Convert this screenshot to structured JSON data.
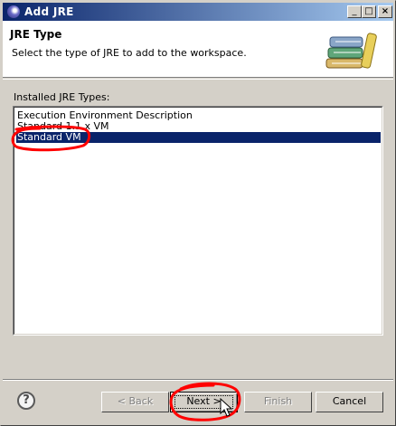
{
  "window": {
    "title": "Add JRE",
    "minimize_glyph": "_",
    "maximize_glyph": "□",
    "close_glyph": "×"
  },
  "header": {
    "title": "JRE Type",
    "description": "Select the type of JRE to add to the workspace.",
    "icon": "books-icon"
  },
  "installed_types": {
    "label": "Installed JRE Types:",
    "items": [
      {
        "label": "Execution Environment Description",
        "selected": false
      },
      {
        "label": "Standard 1.1.x VM",
        "selected": false
      },
      {
        "label": "Standard VM",
        "selected": true
      }
    ]
  },
  "buttons": {
    "help_glyph": "?",
    "back": "< Back",
    "next": "Next >",
    "finish": "Finish",
    "cancel": "Cancel"
  },
  "colors": {
    "selection": "#0a246a",
    "annotation": "#ff0000",
    "titlebar_start": "#0a246a",
    "titlebar_end": "#a6caf0"
  }
}
